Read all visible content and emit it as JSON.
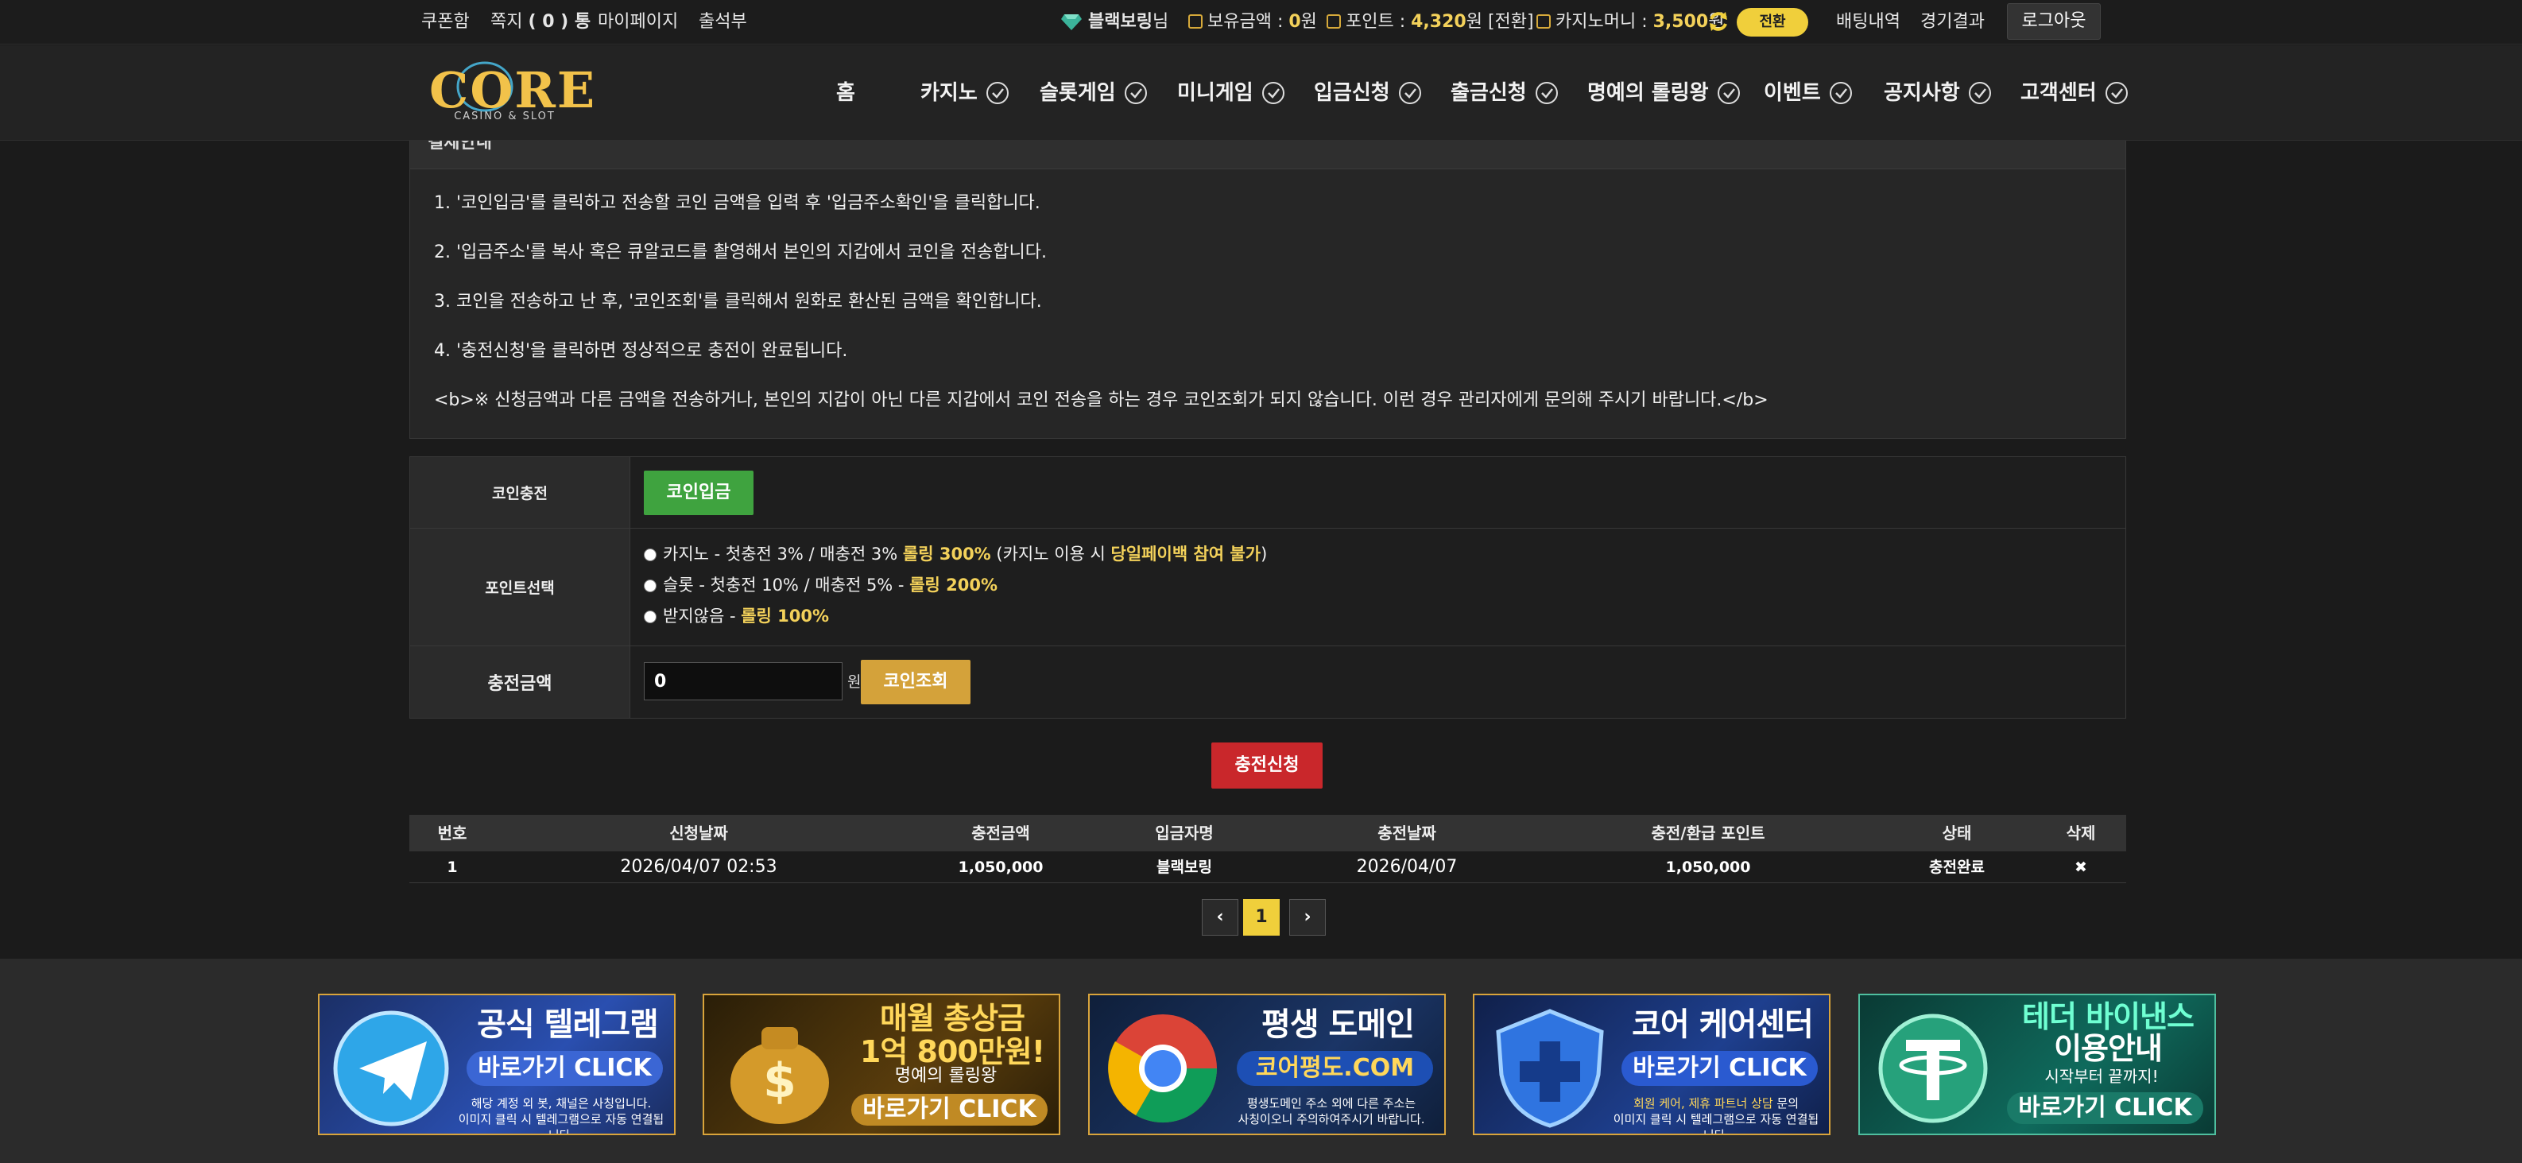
{
  "topbar": {
    "links": [
      "쿠폰함",
      "쪽지",
      "마이페이지",
      "출석부"
    ],
    "message_count": "( 0 ) 통",
    "username": "블랙보링",
    "username_suffix": "님",
    "balance_label": "보유금액 : ",
    "balance_value": "0",
    "balance_unit": "원",
    "point_label": "포인트 : ",
    "point_value": "4,320",
    "point_unit": "원 [전환]",
    "casino_money_label": "카지노머니 : ",
    "casino_money_value": "3,500",
    "casino_money_unit": "원",
    "swap_label": "전환",
    "bet_history": "배팅내역",
    "game_results": "경기결과",
    "logout": "로그아웃"
  },
  "header": {
    "logo_text": "CORE",
    "logo_sub": "CASINO & SLOT",
    "nav": [
      "홈",
      "카지노",
      "슬롯게임",
      "미니게임",
      "입금신청",
      "출금신청",
      "명예의 롤링왕",
      "이벤트",
      "공지사항",
      "고객센터"
    ]
  },
  "notice": {
    "title": "결제안내",
    "lines": [
      "1. '코인입금'를 클릭하고 전송할 코인 금액을 입력 후 '입금주소확인'을 클릭합니다.",
      "2. '입금주소'를 복사 혹은 큐알코드를 촬영해서 본인의 지갑에서 코인을 전송합니다.",
      "3. 코인을 전송하고 난 후, '코인조회'를 클릭해서 원화로 환산된 금액을 확인합니다.",
      "4. '충전신청'을 클릭하면 정상적으로 충전이 완료됩니다.",
      "<b>※ 신청금액과 다른 금액을 전송하거나, 본인의 지갑이 아닌 다른 지갑에서 코인 전송을 하는 경우 코인조회가 되지 않습니다. 이런 경우 관리자에게 문의해 주시기 바랍니다.</b>"
    ]
  },
  "form": {
    "coin_label": "코인충전",
    "coin_button": "코인입금",
    "point_label": "포인트선택",
    "options": [
      {
        "text": "카지노 - 첫충전 3% / 매충전 3% ",
        "highlight": "롤링 300%",
        "extra_pre": " (카지노 이용 시 ",
        "extra_highlight": "당일페이백 참여 불가",
        "extra_post": ")"
      },
      {
        "text": "슬롯 - 첫충전 10% / 매충전 5% - ",
        "highlight": "롤링 200%"
      },
      {
        "text": "받지않음 - ",
        "highlight": "롤링 100%"
      }
    ],
    "amount_label": "충전금액",
    "amount_value": "0",
    "amount_unit": "원",
    "lookup_button": "코인조회",
    "submit_button": "충전신청"
  },
  "table": {
    "headers": [
      "번호",
      "신청날짜",
      "충전금액",
      "입금자명",
      "충전날짜",
      "충전/환급 포인트",
      "상태",
      "삭제"
    ],
    "rows": [
      [
        "1",
        "2026/04/07 02:53",
        "1,050,000",
        "블랙보링",
        "2026/04/07",
        "1,050,000",
        "충전완료",
        "✖"
      ]
    ]
  },
  "pagination": {
    "prev": "‹",
    "current": "1",
    "next": "›"
  },
  "banners": [
    {
      "title": "공식 텔레그램",
      "sub": "바로가기 CLICK",
      "note": "해당 계정 외 봇, 채널은 사칭입니다.\n이미지 클릭 시 텔레그램으로 자동 연결됩니다.",
      "icon": "telegram-icon"
    },
    {
      "title": "매월 총상금",
      "title2": "1억 800만원!",
      "sub_small": "명예의 롤링왕",
      "sub": "바로가기 CLICK",
      "icon": "money-bag-icon"
    },
    {
      "title": "평생 도메인",
      "sub": "코어평도.COM",
      "note": "평생도메인 주소 외에 다른 주소는\n사칭이오니 주의하여주시기 바랍니다.",
      "icon": "chrome-icon"
    },
    {
      "title": "코어 케어센터",
      "sub": "바로가기 CLICK",
      "note_highlight": "회원 케어, 제휴 파트너 상담",
      "note_tail": " 문의",
      "note2": "이미지 클릭 시 텔레그램으로 자동 연결됩니다.",
      "icon": "shield-icon"
    },
    {
      "title": "테더 바이낸스",
      "title2": "이용안내",
      "sub_small": "시작부터 끝까지!",
      "sub": "바로가기 CLICK",
      "icon": "tether-coin-icon"
    }
  ]
}
